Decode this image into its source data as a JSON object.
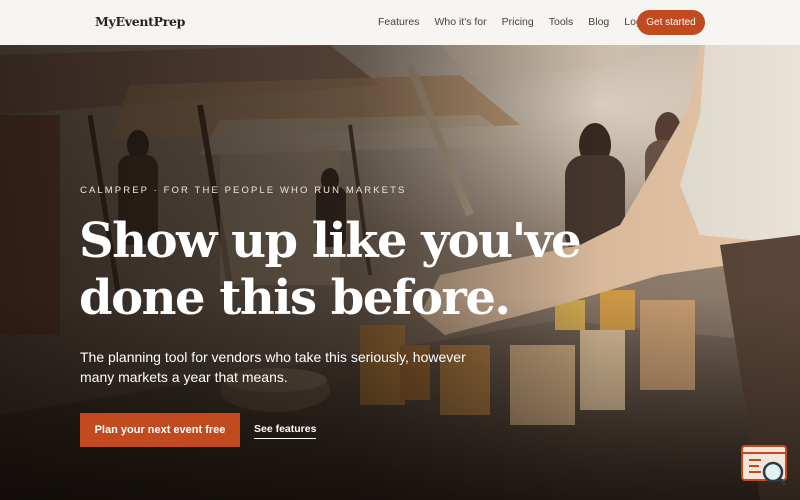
{
  "brand": {
    "name": "MyEventPrep"
  },
  "nav": {
    "links": [
      "Features",
      "Who it's for",
      "Pricing",
      "Tools",
      "Blog",
      "Log in"
    ],
    "cta": "Get started"
  },
  "hero": {
    "eyebrow": "CALMPREP  ·  FOR THE PEOPLE WHO RUN MARKETS",
    "headline_line1": "Show up like you've",
    "headline_line2": "done this before.",
    "subhead": "The planning tool for vendors who take this seriously, however many markets a year that means.",
    "primary_cta": "Plan your next event free",
    "secondary_cta": "See features"
  },
  "widget": {
    "icon": "chat-search-icon"
  },
  "colors": {
    "accent": "#c24a1f",
    "nav_bg": "#f7f5f1",
    "text_dark": "#2a211b"
  }
}
